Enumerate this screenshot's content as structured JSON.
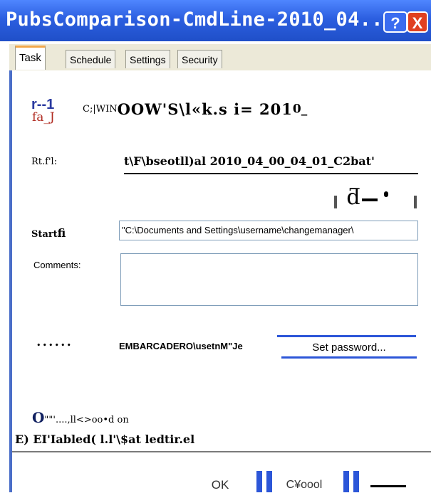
{
  "window": {
    "title": "PubsComparison-CmdLine-2010_04...",
    "help_button": "?",
    "close_button": "X"
  },
  "tabs": [
    "Task",
    "Schedule",
    "Settings",
    "Security"
  ],
  "task": {
    "icon_text": "r--1",
    "icon_subtext": "fa_J",
    "path_prefix": "C;|WIN",
    "path_main": "OOW'S\\l«k.s i= 201",
    "path_suffix": "0_",
    "run_label": "Rt.f'l:",
    "run_value": "t\\F\\bseotll)al 2010_04_00_04_01_C2bat'",
    "start_label_a": "Start",
    "start_label_b": "fi",
    "start_value": "\"C:\\Documents and Settings\\username\\changemanager\\",
    "comments_label": "Comments:",
    "comments_value": "",
    "runas_label": "••••••",
    "runas_value": "EMBARCADERO\\usetnM\"Je",
    "set_password_button": "Set password...",
    "enabled_line1_big": "O",
    "enabled_line1_rest": "\"\"'....,ll<>oo•d on",
    "enabled_line2": "E) EI'Iabled(    l.l'\\$at ledtir.el"
  },
  "footer": {
    "ok_button": "OK",
    "cancel_button": "C¥oool"
  },
  "colors": {
    "titlebar": "#2c5fe0",
    "accent_tab": "#f2a84a",
    "bar_blue": "#2c56d8"
  }
}
